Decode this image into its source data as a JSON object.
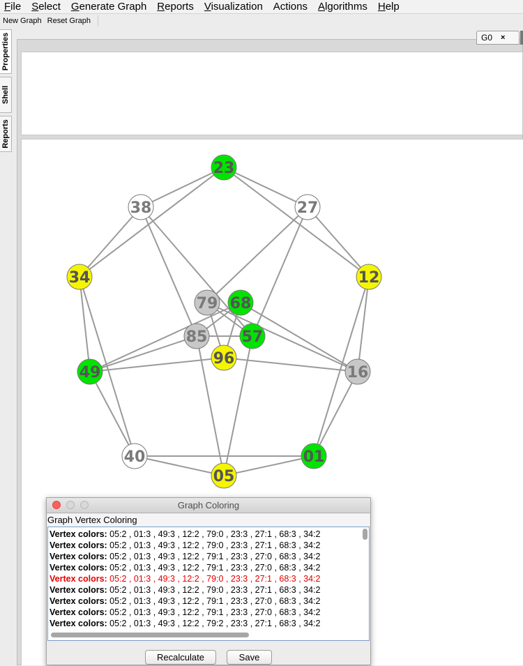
{
  "menu": [
    "File",
    "Select",
    "Generate Graph",
    "Reports",
    "Visualization",
    "Actions",
    "Algorithms",
    "Help"
  ],
  "menu_mnemonic": [
    "F",
    "S",
    "G",
    "R",
    "V",
    "",
    "A",
    "H"
  ],
  "toolbar": {
    "new_graph": "New Graph",
    "reset_graph": "Reset Graph"
  },
  "side_tabs": [
    "Properties",
    "Shell",
    "Reports"
  ],
  "document_tab": {
    "label": "G0",
    "close": "×"
  },
  "colors": {
    "green": "#00e400",
    "yellow": "#f5f500",
    "gray": "#c8c8c8",
    "white": "#ffffff",
    "edge": "#9a9a9a",
    "highlight_row": "#e60000"
  },
  "graph": {
    "vertices": [
      {
        "id": "23",
        "color": "green"
      },
      {
        "id": "38",
        "color": "white"
      },
      {
        "id": "27",
        "color": "white"
      },
      {
        "id": "34",
        "color": "yellow"
      },
      {
        "id": "12",
        "color": "yellow"
      },
      {
        "id": "79",
        "color": "gray"
      },
      {
        "id": "68",
        "color": "green"
      },
      {
        "id": "85",
        "color": "gray"
      },
      {
        "id": "57",
        "color": "green"
      },
      {
        "id": "96",
        "color": "yellow"
      },
      {
        "id": "49",
        "color": "green"
      },
      {
        "id": "16",
        "color": "gray"
      },
      {
        "id": "40",
        "color": "white"
      },
      {
        "id": "01",
        "color": "green"
      },
      {
        "id": "05",
        "color": "yellow"
      }
    ],
    "edges": [
      [
        "23",
        "38"
      ],
      [
        "23",
        "27"
      ],
      [
        "23",
        "34"
      ],
      [
        "23",
        "12"
      ],
      [
        "38",
        "34"
      ],
      [
        "38",
        "57"
      ],
      [
        "38",
        "85"
      ],
      [
        "27",
        "12"
      ],
      [
        "27",
        "79"
      ],
      [
        "27",
        "57"
      ],
      [
        "34",
        "49"
      ],
      [
        "34",
        "40"
      ],
      [
        "12",
        "16"
      ],
      [
        "12",
        "01"
      ],
      [
        "49",
        "40"
      ],
      [
        "49",
        "85"
      ],
      [
        "49",
        "96"
      ],
      [
        "49",
        "68"
      ],
      [
        "16",
        "01"
      ],
      [
        "16",
        "96"
      ],
      [
        "16",
        "79"
      ],
      [
        "16",
        "68"
      ],
      [
        "40",
        "05"
      ],
      [
        "40",
        "01"
      ],
      [
        "01",
        "05"
      ],
      [
        "05",
        "85"
      ],
      [
        "05",
        "57"
      ],
      [
        "79",
        "96"
      ],
      [
        "79",
        "57"
      ],
      [
        "68",
        "85"
      ],
      [
        "68",
        "96"
      ],
      [
        "85",
        "57"
      ]
    ]
  },
  "dialog": {
    "title": "Graph Coloring",
    "heading": "Graph Vertex Coloring",
    "row_prefix": "Vertex colors:",
    "rows": [
      {
        "text": " 05:2 , 01:3 , 49:3 , 12:2 , 79:0 , 23:3 , 27:1 , 68:3 , 34:2",
        "highlight": false
      },
      {
        "text": " 05:2 , 01:3 , 49:3 , 12:2 , 79:0 , 23:3 , 27:1 , 68:3 , 34:2",
        "highlight": false
      },
      {
        "text": " 05:2 , 01:3 , 49:3 , 12:2 , 79:1 , 23:3 , 27:0 , 68:3 , 34:2",
        "highlight": false
      },
      {
        "text": " 05:2 , 01:3 , 49:3 , 12:2 , 79:1 , 23:3 , 27:0 , 68:3 , 34:2",
        "highlight": false
      },
      {
        "text": " 05:2 , 01:3 , 49:3 , 12:2 , 79:0 , 23:3 , 27:1 , 68:3 , 34:2",
        "highlight": true
      },
      {
        "text": " 05:2 , 01:3 , 49:3 , 12:2 , 79:0 , 23:3 , 27:1 , 68:3 , 34:2",
        "highlight": false
      },
      {
        "text": " 05:2 , 01:3 , 49:3 , 12:2 , 79:1 , 23:3 , 27:0 , 68:3 , 34:2",
        "highlight": false
      },
      {
        "text": " 05:2 , 01:3 , 49:3 , 12:2 , 79:1 , 23:3 , 27:0 , 68:3 , 34:2",
        "highlight": false
      },
      {
        "text": " 05:2 , 01:3 , 49:3 , 12:2 , 79:2 , 23:3 , 27:1 , 68:3 , 34:2",
        "highlight": false
      }
    ],
    "buttons": {
      "recalculate": "Recalculate",
      "save": "Save"
    }
  }
}
